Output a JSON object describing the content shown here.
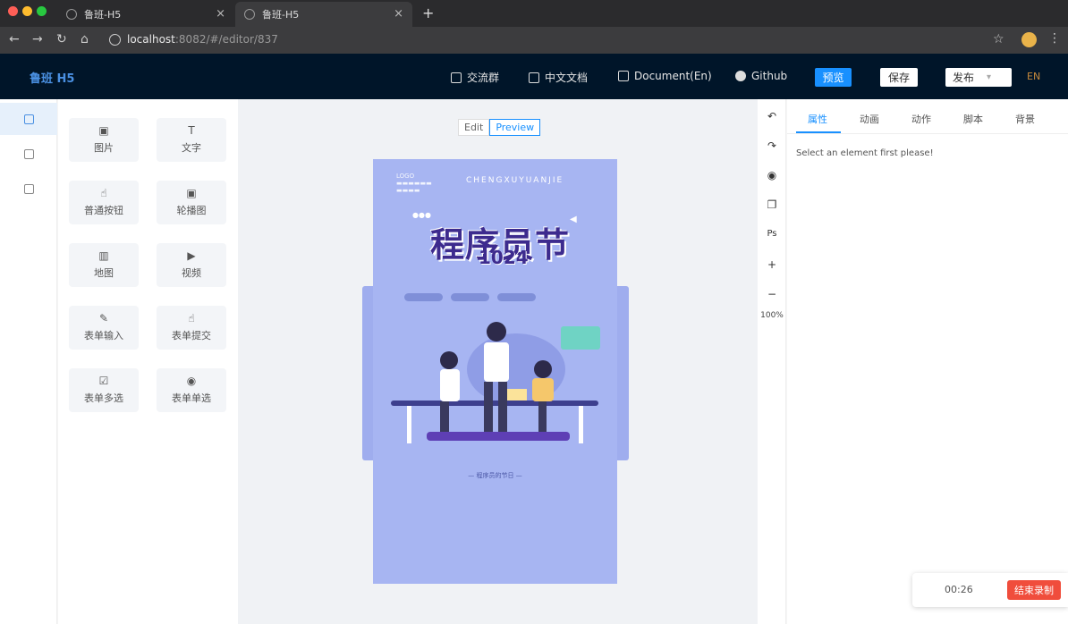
{
  "browser": {
    "tabs": [
      {
        "title": "鲁班-H5"
      },
      {
        "title": "鲁班-H5"
      }
    ],
    "url_host": "localhost",
    "url_rest": ":8082/#/editor/837"
  },
  "header": {
    "brand": "鲁班 H5",
    "links": [
      "交流群",
      "中文文档",
      "Document(En)",
      "Github"
    ],
    "preview_label": "预览",
    "save_label": "保存",
    "publish_label": "发布",
    "lang": "EN"
  },
  "components": [
    {
      "label": "图片",
      "icon": "image-icon",
      "glyph": "▣"
    },
    {
      "label": "文字",
      "icon": "text-icon",
      "glyph": "T"
    },
    {
      "label": "普通按钮",
      "icon": "pointer-icon",
      "glyph": "☝"
    },
    {
      "label": "轮播图",
      "icon": "carousel-icon",
      "glyph": "▣"
    },
    {
      "label": "地图",
      "icon": "map-icon",
      "glyph": "▥"
    },
    {
      "label": "视频",
      "icon": "video-icon",
      "glyph": "▶"
    },
    {
      "label": "表单输入",
      "icon": "edit-icon",
      "glyph": "✎"
    },
    {
      "label": "表单提交",
      "icon": "submit-icon",
      "glyph": "☝"
    },
    {
      "label": "表单多选",
      "icon": "checkbox-icon",
      "glyph": "☑"
    },
    {
      "label": "表单单选",
      "icon": "radio-icon",
      "glyph": "◉"
    }
  ],
  "canvas": {
    "mode_edit": "Edit",
    "mode_preview": "Preview",
    "poster_logo": "LOGO",
    "poster_subtitle": "CHENGXUYUANJIE",
    "poster_title": "程序员节",
    "poster_number": "1024",
    "poster_footer": "— 程序员的节日 —"
  },
  "toolbar": {
    "zoom": "100%"
  },
  "props": {
    "tabs": [
      "属性",
      "动画",
      "动作",
      "脚本",
      "背景"
    ],
    "hint": "Select an element first please!"
  },
  "recorder": {
    "time": "00:26",
    "stop_label": "结束录制"
  },
  "colors": {
    "header_bg": "#001529",
    "primary": "#1890ff",
    "poster_bg": "#a7b5f2",
    "stop_btn": "#f04d3c"
  }
}
